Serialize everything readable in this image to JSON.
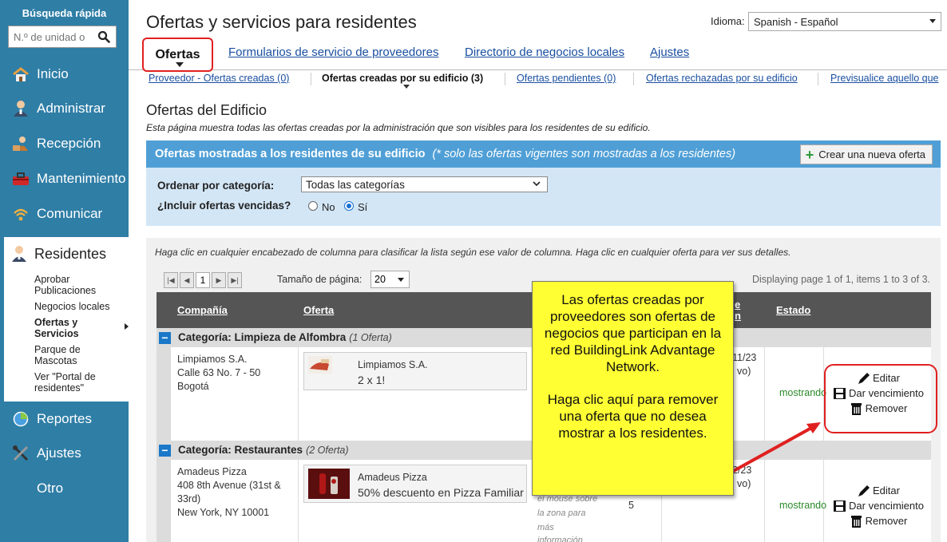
{
  "sidebar": {
    "quick_search_title": "Búsqueda rápida",
    "quick_search_placeholder": "N.º de unidad o",
    "nav": [
      {
        "label": "Inicio"
      },
      {
        "label": "Administrar"
      },
      {
        "label": "Recepción"
      },
      {
        "label": "Mantenimiento"
      },
      {
        "label": "Comunicar"
      }
    ],
    "residents": {
      "label": "Residentes",
      "items": [
        "Aprobar Publicaciones",
        "Negocios locales",
        "Ofertas y Servicios",
        "Parque de Mascotas",
        "Ver \"Portal de residentes\""
      ]
    },
    "nav_bottom": [
      {
        "label": "Reportes"
      },
      {
        "label": "Ajustes"
      },
      {
        "label": "Otro"
      }
    ]
  },
  "header": {
    "title": "Ofertas y servicios para residentes",
    "language_label": "Idioma:",
    "language_value": "Spanish - Español"
  },
  "tabs": {
    "active": "Ofertas",
    "links": [
      "Formularios de servicio de proveedores",
      "Directorio de negocios locales",
      "Ajustes"
    ]
  },
  "subtabs": [
    {
      "label": "Proveedor - Ofertas creadas (0)"
    },
    {
      "label": "Ofertas creadas por su edificio (3)"
    },
    {
      "label": "Ofertas pendientes (0)"
    },
    {
      "label": "Ofertas rechazadas por su edificio"
    },
    {
      "label": "Previsualice aquello que"
    }
  ],
  "section": {
    "title": "Ofertas del Edificio",
    "description": "Esta página muestra todas las ofertas creadas por la administración que son visibles para los residentes de su edificio."
  },
  "bar": {
    "title": "Ofertas mostradas a los residentes de su edificio",
    "note": "(* solo las ofertas vigentes son mostradas a los residentes)",
    "create_button": "Crear una nueva oferta"
  },
  "filters": {
    "category_label": "Ordenar por categoría:",
    "category_value": "Todas las categorías",
    "include_label": "¿Incluir ofertas vencidas?",
    "no_label": "No",
    "yes_label": "Sí"
  },
  "grid": {
    "hint": "Haga clic en cualquier encabezado de columna para clasificar la lista según ese valor de columna. Haga clic en cualquier oferta para ver sus detalles.",
    "page": "1",
    "page_size_label": "Tamaño de página:",
    "page_size": "20",
    "page_info": "Displaying page 1 of 1, items 1 to 3 of 3.",
    "columns": {
      "company": "Compañía",
      "offer": "Oferta",
      "partial_e": "e",
      "partial_n": "n",
      "status": "Estado"
    },
    "categories": [
      {
        "name": "Categoría: Limpieza de Alfombra",
        "count": "(1 Oferta)"
      },
      {
        "name": "Categoría: Restaurantes",
        "count": "(2 Oferta)"
      }
    ],
    "rows": [
      {
        "company_name": "Limpiamos S.A.",
        "company_addr1": "Calle 63 No. 7 - 50",
        "company_addr2": "Bogotá",
        "offer_name": "Limpiamos S.A.",
        "offer_title": "2 x 1!",
        "date_partial": "11/23",
        "date_partial2": "vo)",
        "status": "mostrando",
        "edit": "Editar",
        "expire": "Dar vencimiento",
        "remove": "Remover"
      },
      {
        "company_name": "Amadeus Pizza",
        "company_addr1": "408 8th Avenue (31st &",
        "company_addr2": "33rd)",
        "company_addr3": "New York, NY 10001",
        "offer_name": "Amadeus Pizza",
        "offer_title": "50% descuento en Pizza Familiar",
        "hover_hint_1": "el mouse sobre",
        "hover_hint_2": "la zona para",
        "hover_hint_3": "más",
        "hover_hint_4": "información",
        "count": "5",
        "date_partial": "2/23",
        "date_partial2": "vo)",
        "status": "mostrando",
        "edit": "Editar",
        "expire": "Dar vencimiento",
        "remove": "Remover"
      }
    ]
  },
  "callout": {
    "para1": "Las ofertas creadas por proveedores son ofertas de negocios que participan en la red BuildingLink Advantage Network.",
    "para2": "Haga clic aquí para remover una oferta que no desea mostrar a los residentes."
  },
  "colors": {
    "sidebar": "#2f7ea6",
    "accent_blue": "#4f9fd6",
    "annotation_red": "#e02020",
    "callout_yellow": "#ffff33"
  }
}
